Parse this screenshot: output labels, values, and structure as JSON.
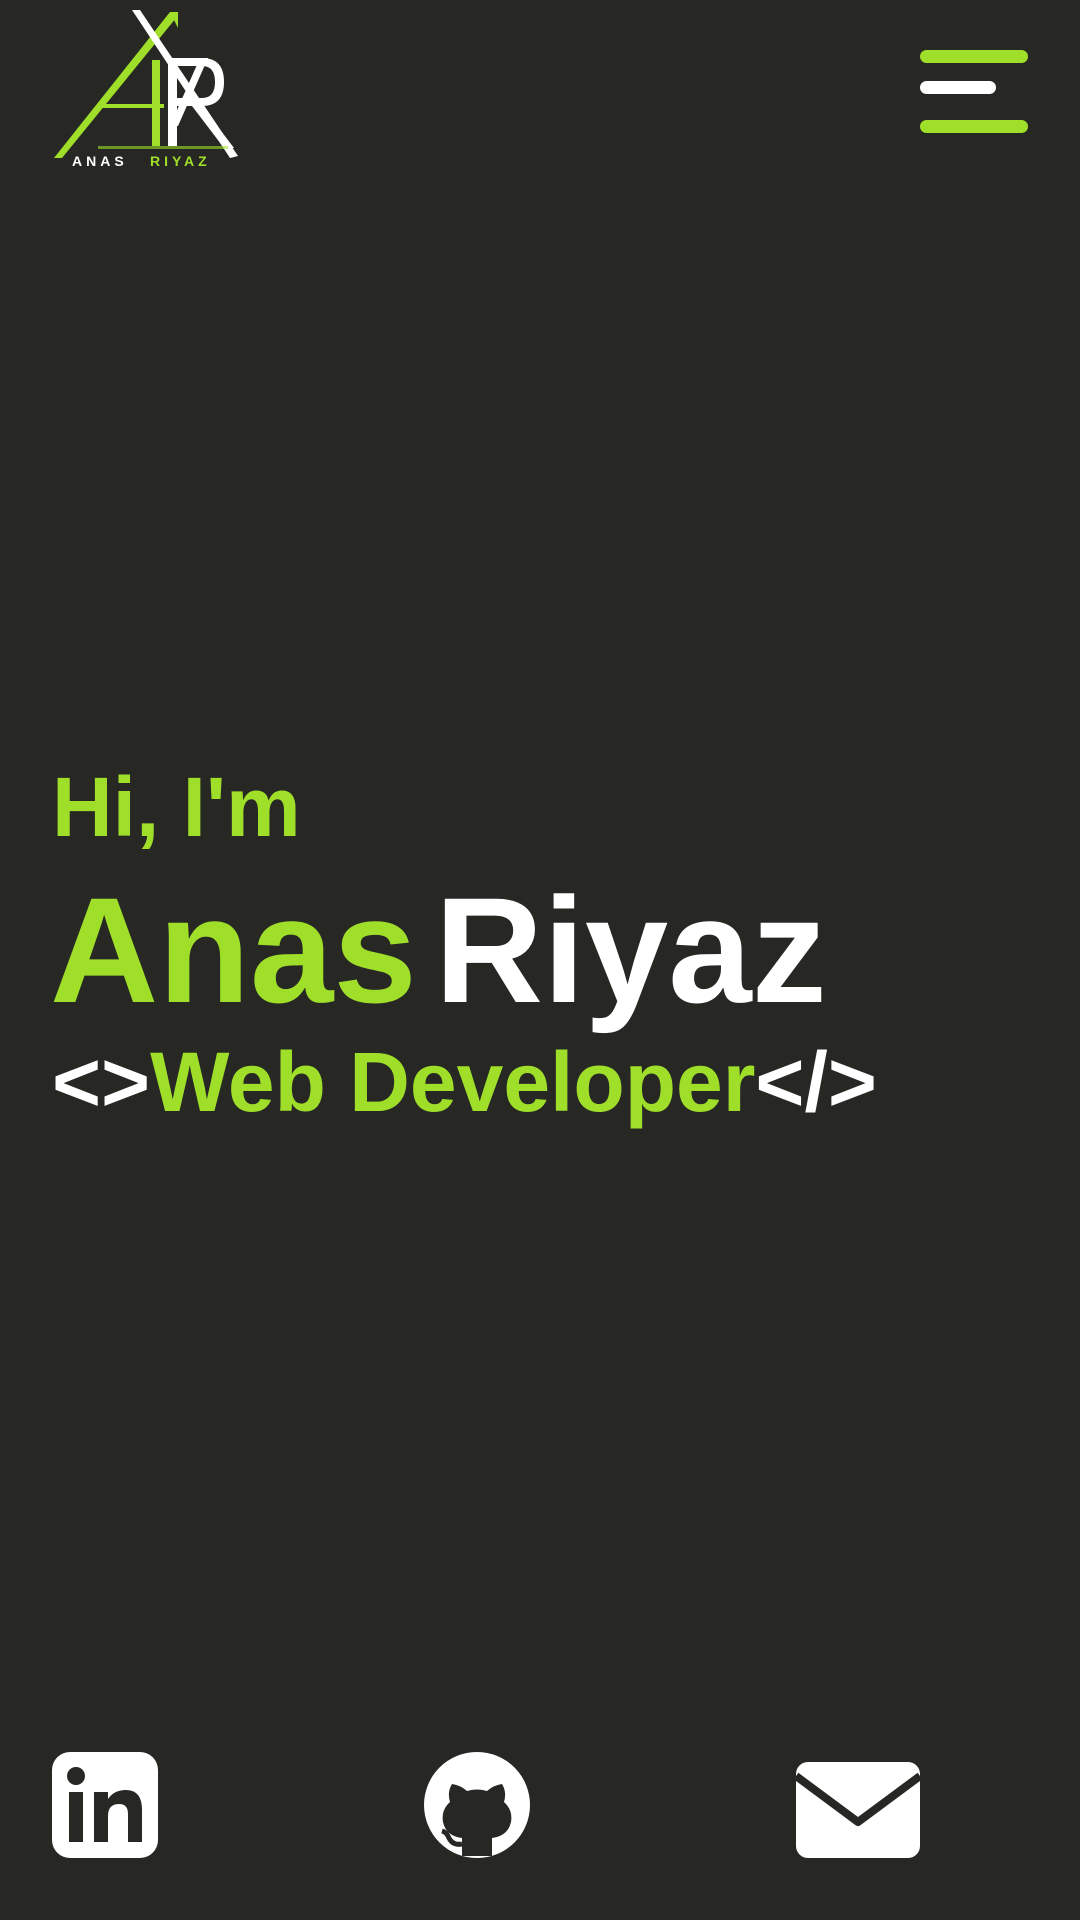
{
  "colors": {
    "background": "#272824",
    "accent": "#9fdf2a",
    "white": "#ffffff"
  },
  "header": {
    "logo": {
      "monogram": "AR",
      "text_first": "ANAS",
      "text_last": "RIYAZ"
    },
    "menu_icon": "hamburger-menu-icon"
  },
  "hero": {
    "greeting": "Hi, I'm",
    "name_first": "Anas",
    "name_last": "Riyaz",
    "role_open_tag": "<>",
    "role": "Web Developer",
    "role_close_tag": "</>"
  },
  "social": [
    {
      "icon": "linkedin-icon"
    },
    {
      "icon": "github-icon"
    },
    {
      "icon": "mail-icon"
    }
  ]
}
